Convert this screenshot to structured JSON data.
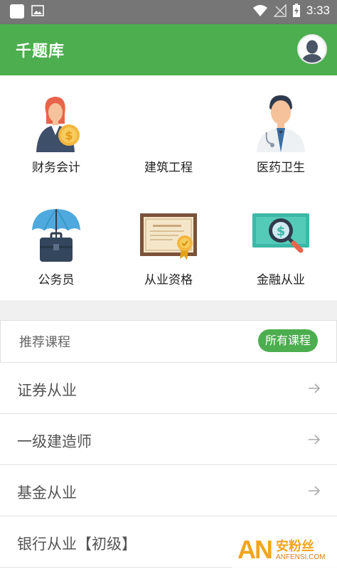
{
  "status_bar": {
    "time": "3:33"
  },
  "app_bar": {
    "title": "千题库"
  },
  "categories": [
    {
      "label": "财务会计",
      "icon": "accountant-icon"
    },
    {
      "label": "建筑工程",
      "icon": "construction-engineer-icon"
    },
    {
      "label": "医药卫生",
      "icon": "doctor-icon"
    },
    {
      "label": "公务员",
      "icon": "civil-servant-umbrella-icon"
    },
    {
      "label": "从业资格",
      "icon": "certificate-icon"
    },
    {
      "label": "金融从业",
      "icon": "finance-magnifier-icon"
    }
  ],
  "recommended": {
    "title": "推荐课程",
    "all_button": "所有课程"
  },
  "courses": [
    {
      "label": "证券从业"
    },
    {
      "label": "一级建造师"
    },
    {
      "label": "基金从业"
    },
    {
      "label": "银行从业【初级】"
    }
  ],
  "watermark": {
    "brand": "AN",
    "cn": "安粉丝",
    "en": "ANFENSI.COM"
  },
  "colors": {
    "primary": "#4cae4f",
    "status_bar": "#767676",
    "watermark": "#f2a51c"
  }
}
